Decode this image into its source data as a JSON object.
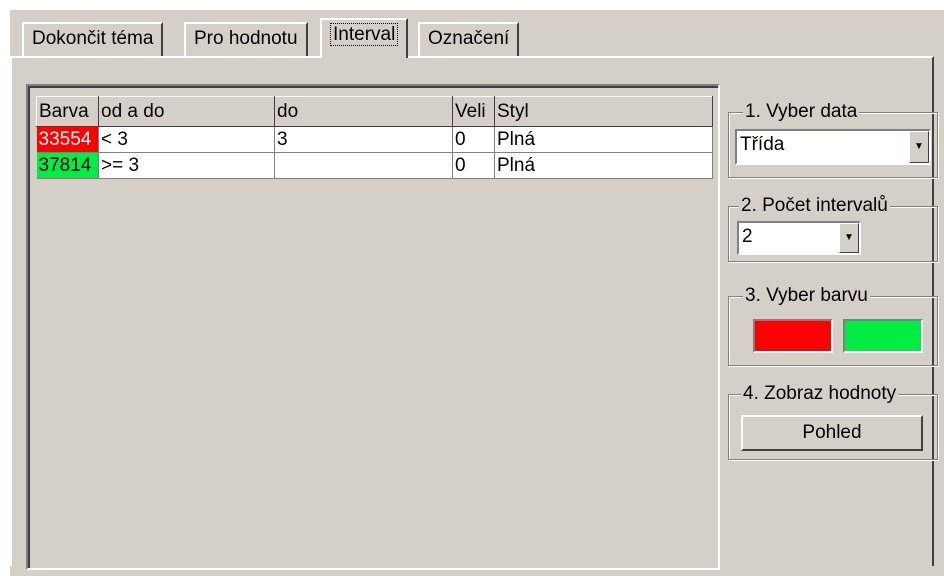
{
  "tabs": [
    {
      "label": "Dokončit téma"
    },
    {
      "label": "Pro hodnotu"
    },
    {
      "label": "Interval"
    },
    {
      "label": "Označení"
    }
  ],
  "grid": {
    "headers": [
      "Barva",
      "od a do",
      "do",
      "Veli",
      "Styl"
    ],
    "rows": [
      {
        "color_value": "33554",
        "color": "#ff0000",
        "from": "< 3",
        "to": "3",
        "size": "0",
        "style": "Plná"
      },
      {
        "color_value": "37814",
        "color": "#00ee44",
        "from": ">= 3",
        "to": "",
        "size": "0",
        "style": "Plná"
      }
    ]
  },
  "step1": {
    "label": "1. Vyber data",
    "value": "Třída"
  },
  "step2": {
    "label": "2. Počet intervalů",
    "value": "2"
  },
  "step3": {
    "label": "3. Vyber barvu",
    "colors": [
      "#ff0000",
      "#00ee44"
    ]
  },
  "step4": {
    "label": "4. Zobraz hodnoty",
    "button": "Pohled"
  }
}
